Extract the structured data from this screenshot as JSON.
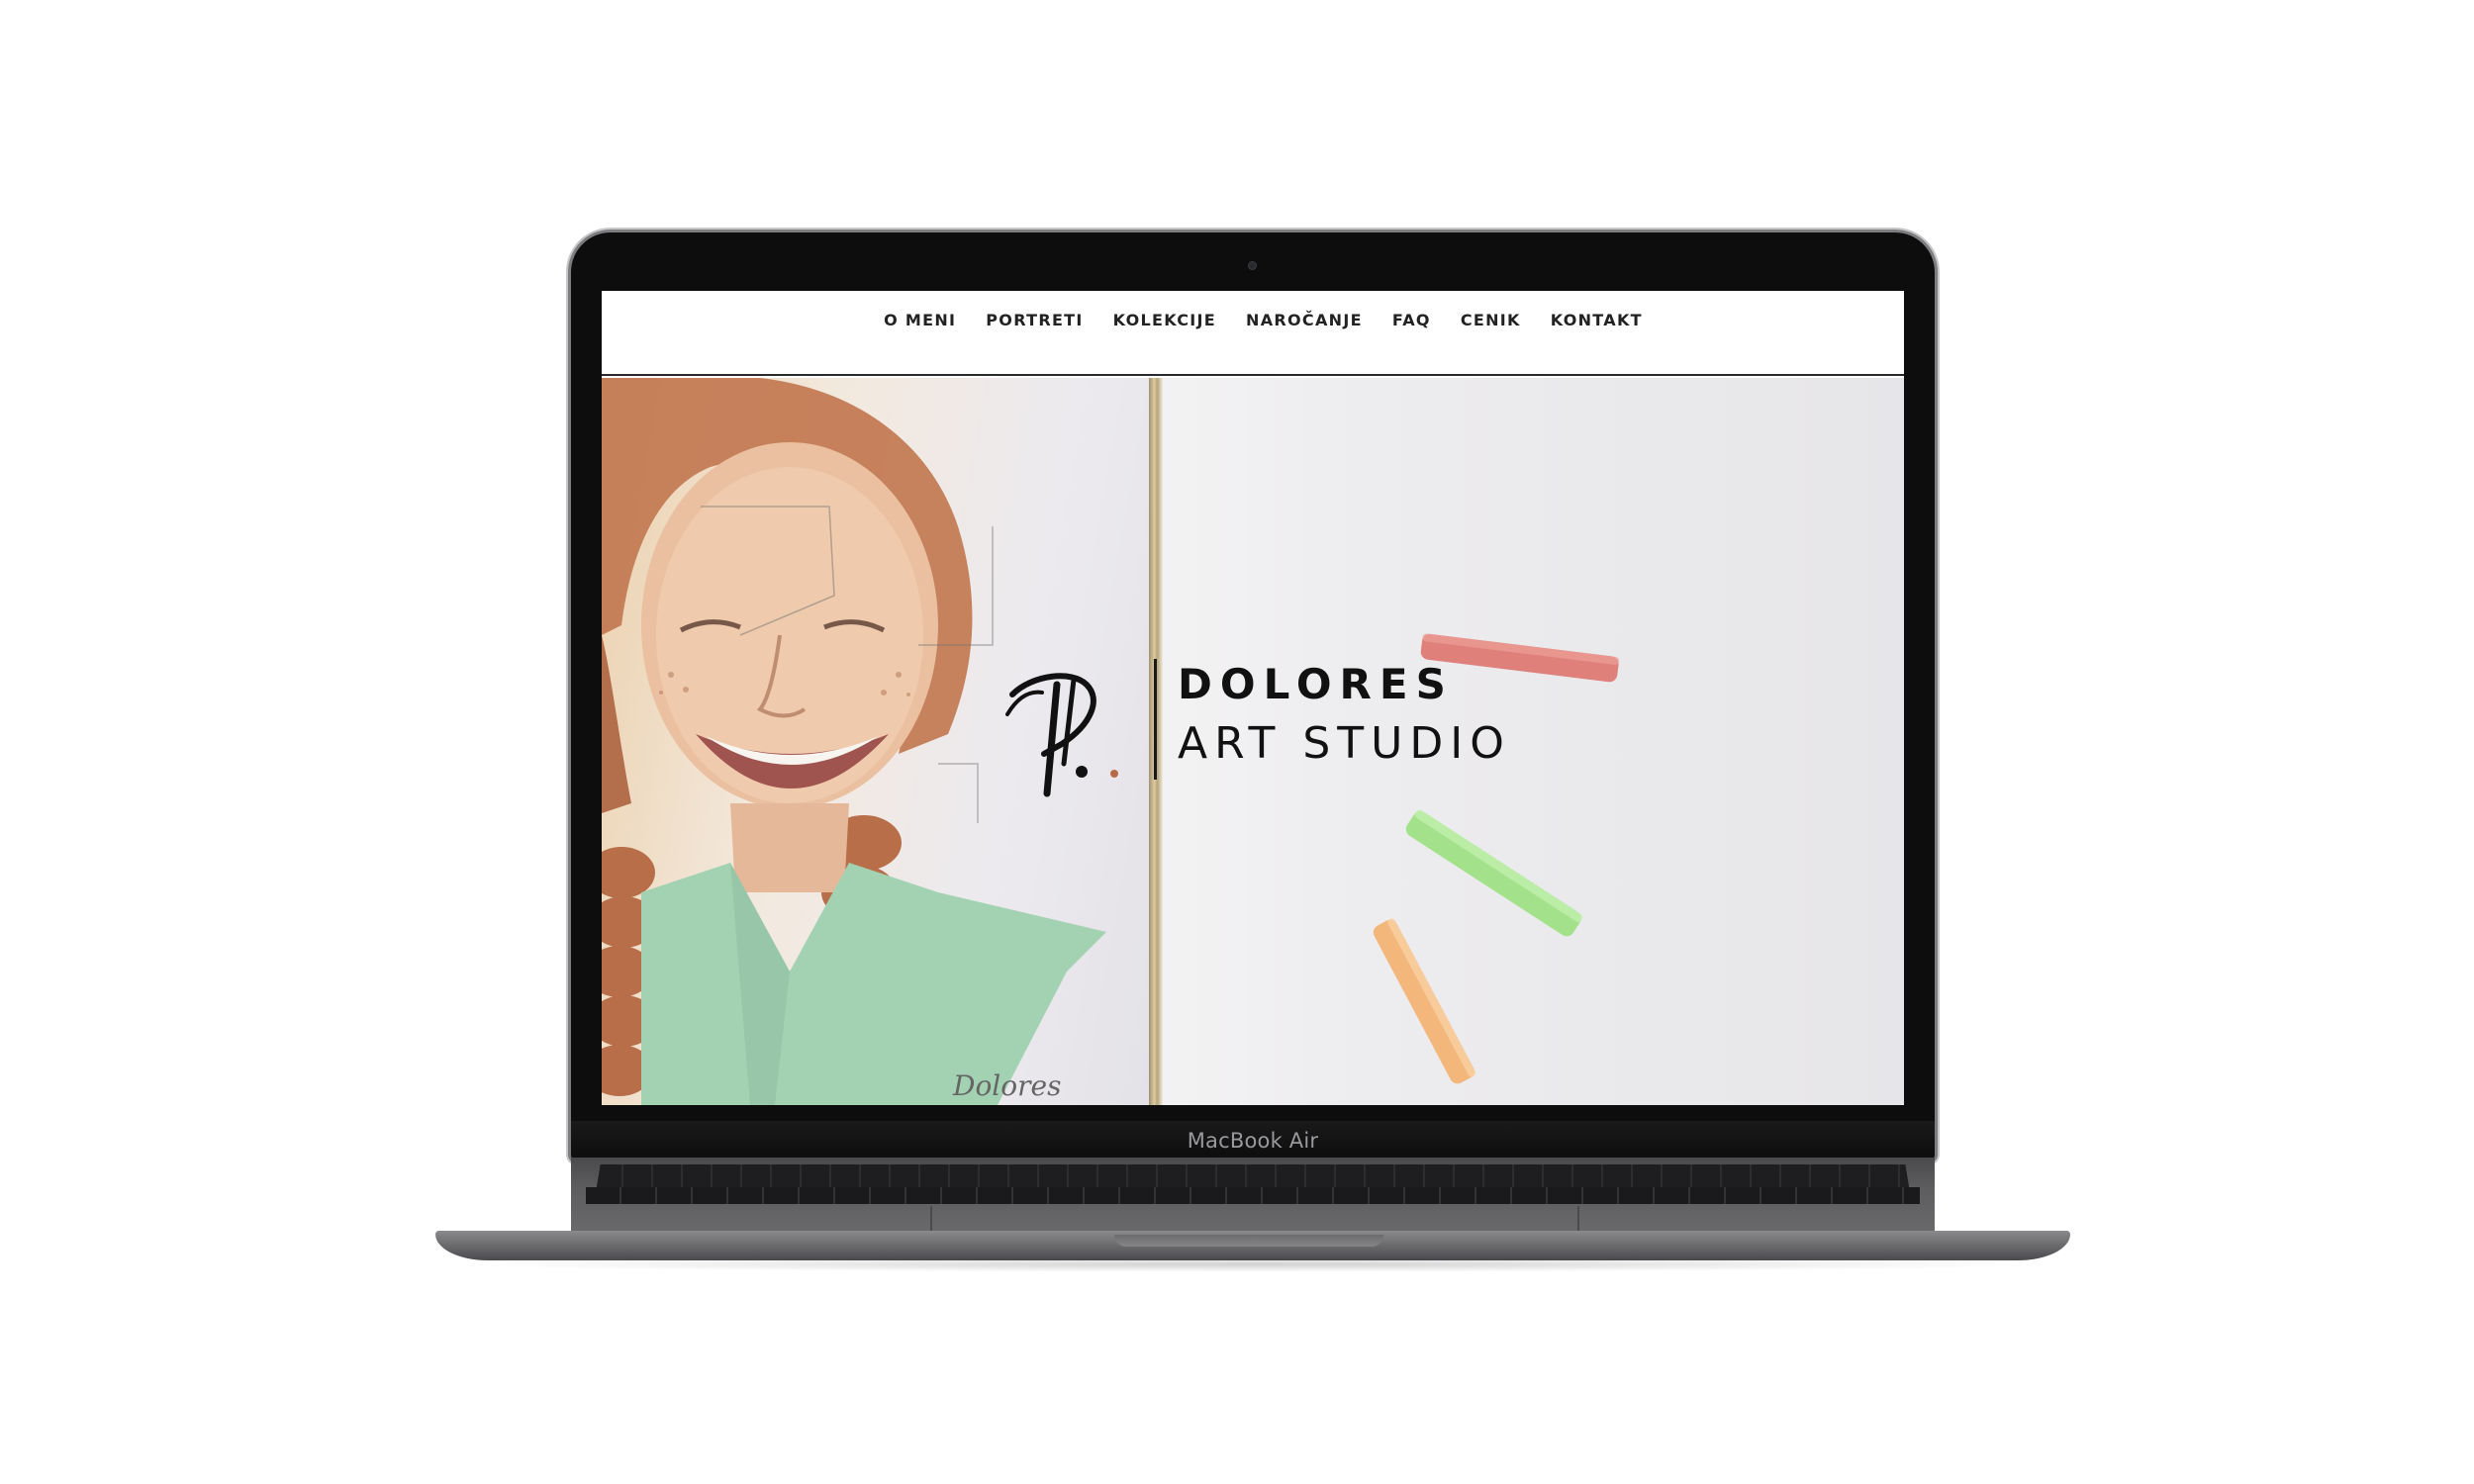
{
  "device": {
    "model_label": "MacBook Air"
  },
  "nav": {
    "items": [
      {
        "label": "O MENI"
      },
      {
        "label": "PORTRETI"
      },
      {
        "label": "KOLEKCIJE"
      },
      {
        "label": "NAROČANJE"
      },
      {
        "label": "FAQ"
      },
      {
        "label": "CENIK"
      },
      {
        "label": "KONTAKT"
      }
    ]
  },
  "hero": {
    "logo_title": "DOLORES",
    "logo_subtitle": "ART STUDIO",
    "signature_text": "Dolores"
  },
  "colors": {
    "chalk_red": "#d9655e",
    "chalk_green": "#8fdc72",
    "chalk_orange": "#f2a85f",
    "hair": "#b35a2c",
    "shirt": "#8fc7a1",
    "bezel": "#0d0d0e",
    "nav_text": "#222222"
  }
}
